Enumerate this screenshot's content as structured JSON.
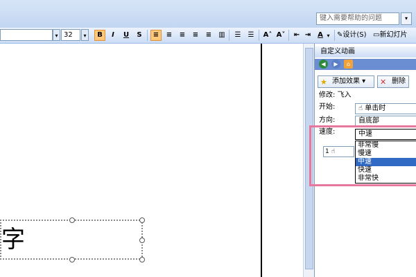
{
  "help": {
    "placeholder": "键入需要帮助的问题",
    "arrow": "▾"
  },
  "toolbar": {
    "font_size": "32",
    "bold": "B",
    "italic": "I",
    "underline": "U",
    "shadow": "S",
    "align_left": "≡",
    "design_label": "设计(S)",
    "new_slide_label": "新幻灯片",
    "font_color_label": "A",
    "increase_font": "A˄",
    "decrease_font": "A˅",
    "dropdown_arrow": "▾",
    "align_center": "≡",
    "align_right": "≡",
    "justify": "≡",
    "distribute": "≡",
    "columns": "▥",
    "bullets": "☰",
    "numbering": "☰",
    "outdent": "⇤",
    "indent": "⇥"
  },
  "slide": {
    "textbox_text": "字"
  },
  "pane": {
    "title": "自定义动画",
    "add_effect_label": "添加效果 ▾",
    "remove_label": "删除",
    "modify_label": "修改: 飞入",
    "start_label": "开始:",
    "start_value": "单击时",
    "direction_label": "方向:",
    "direction_value": "自底部",
    "speed_label": "速度:",
    "speed_value": "中速",
    "speed_options": [
      "非常慢",
      "慢速",
      "中速",
      "快速",
      "非常快"
    ],
    "selected_speed": "中速",
    "effect_item_index": "1",
    "back_icon": "◀",
    "forward_icon": "▶",
    "home_icon": "⌂",
    "add_effect_icon": "★",
    "remove_icon": "✕",
    "mouse_icon": "☝",
    "effect_icon": "☝",
    "design_icon": "✎",
    "new_slide_icon": "▭"
  },
  "colors": {
    "highlight": "#e8779e",
    "selection": "#316ac5",
    "toolbar_active": "#ffc979"
  }
}
